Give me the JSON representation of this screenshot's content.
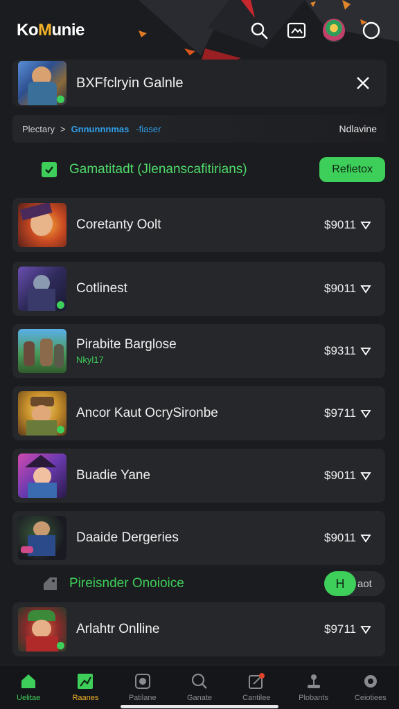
{
  "app": {
    "logo_a": "Ko",
    "logo_b": "M",
    "logo_c": "unie"
  },
  "banner": {
    "title": "BXFfclryin Galnle"
  },
  "breadcrumb": {
    "first": "Plectary",
    "separator": ">",
    "second": "Gnnunnnmas",
    "third": "-fiaser",
    "right": "Ndlavine"
  },
  "filter": {
    "label": "Gamatitadt (Jlenanscafitirians)",
    "button": "Refietox",
    "checked": true
  },
  "games": [
    {
      "name": "Coretanty Oolt",
      "sub": "",
      "price": "$9011"
    },
    {
      "name": "Cotlinest",
      "sub": "",
      "price": "$9011"
    },
    {
      "name": "Pirabite Barglose",
      "sub": "Nkyl17",
      "price": "$9311"
    },
    {
      "name": "Ancor Kaut OcrySironbe",
      "sub": "",
      "price": "$9711"
    },
    {
      "name": "Buadie Yane",
      "sub": "",
      "price": "$9011"
    },
    {
      "name": "Daaide Dergeries",
      "sub": "",
      "price": "$9011"
    }
  ],
  "sub_filter": {
    "label": "Pireisnder Onoioice",
    "toggle_knob": "H",
    "toggle_text": "aot"
  },
  "last_game": {
    "name": "Arlahtr Onlline",
    "price": "$9711"
  },
  "nav": [
    {
      "label": "Uelitae",
      "icon": "home-icon"
    },
    {
      "label": "Raanes",
      "icon": "chart-icon"
    },
    {
      "label": "Patilane",
      "icon": "camera-icon"
    },
    {
      "label": "Ganate",
      "icon": "search-icon"
    },
    {
      "label": "Cantilee",
      "icon": "edit-icon"
    },
    {
      "label": "Plobants",
      "icon": "joystick-icon"
    },
    {
      "label": "Ceiotiees",
      "icon": "settings-icon"
    }
  ],
  "colors": {
    "accent": "#3ecf5a",
    "brand_gold": "#f2b227",
    "link": "#2f9ee8",
    "background": "#1b1c1f",
    "card": "#26272b"
  }
}
